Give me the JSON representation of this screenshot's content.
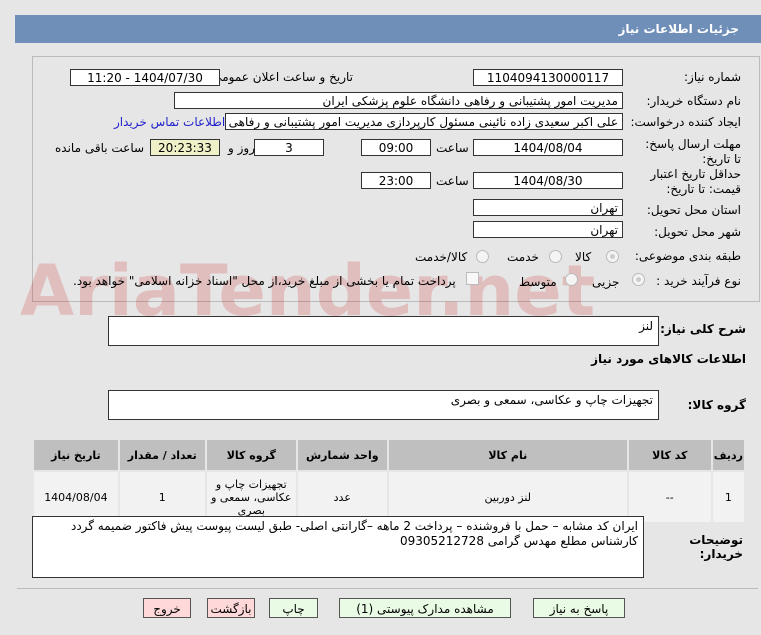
{
  "title": "جزئیات اطلاعات نیاز",
  "fields": {
    "need_number_label": "شماره نیاز:",
    "need_number": "1104094130000117",
    "announce_label": "تاریخ و ساعت اعلان عمومی:",
    "announce": "1404/07/30 - 11:20",
    "buyer_label": "نام دستگاه خریدار:",
    "buyer": "مدیریت امور پشتیبانی و رفاهی دانشگاه علوم پزشکی ایران",
    "creator_label": "ایجاد کننده درخواست:",
    "creator": "علی اکبر سعیدی زاده نائینی مسئول کارپردازی مدیریت امور پشتیبانی و رفاهی",
    "contact_link": "اطلاعات تماس خریدار",
    "deadline_label": "مهلت ارسال پاسخ: تا تاریخ:",
    "deadline_date": "1404/08/04",
    "time_label": "ساعت",
    "deadline_time": "09:00",
    "days": "3",
    "days_label": "روز و",
    "remaining": "20:23:33",
    "remaining_label": "ساعت باقی مانده",
    "validity_label": "حداقل تاریخ اعتبار قیمت: تا تاریخ:",
    "validity_date": "1404/08/30",
    "validity_time": "23:00",
    "province_label": "استان محل تحویل:",
    "province": "تهران",
    "city_label": "شهر محل تحویل:",
    "city": "تهران",
    "category_label": "طبقه بندی موضوعی:",
    "cat_options": [
      "کالا",
      "خدمت",
      "کالا/خدمت"
    ],
    "process_label": "نوع فرآیند خرید :",
    "proc_options": [
      "جزیی",
      "متوسط"
    ],
    "payment_note": "پرداخت تمام یا بخشی از مبلغ خرید،از محل \"اسناد خزانه اسلامی\" خواهد بود."
  },
  "summary_label": "شرح کلی نیاز:",
  "summary": "لنز",
  "goods_info_title": "اطلاعات کالاهای مورد نیاز",
  "goods_group_label": "گروه کالا:",
  "goods_group": "تجهیزات چاپ و عکاسی، سمعی و بصری",
  "table": {
    "headers": [
      "ردیف",
      "کد کالا",
      "نام کالا",
      "واحد شمارش",
      "گروه کالا",
      "تعداد / مقدار",
      "تاریخ نیاز"
    ],
    "rows": [
      [
        "1",
        "--",
        "لنز دوربین",
        "عدد",
        "تجهیزات چاپ و عکاسی، سمعی و بصری",
        "1",
        "1404/08/04"
      ]
    ]
  },
  "notes_label": "توضیحات خریدار:",
  "notes": [
    "ایران کد مشابه – حمل با فروشنده – پرداخت 2 ماهه –گارانتی اصلی- طبق لیست پیوست پیش فاکتور ضمیمه گردد",
    "کارشناس مطلع مهدس گرامی 09305212728"
  ],
  "buttons": {
    "reply": "پاسخ به نیاز",
    "docs": "مشاهده مدارک پیوستی (1)",
    "print": "چاپ",
    "back": "بازگشت",
    "exit": "خروج"
  },
  "watermark": "AriaTender.net"
}
